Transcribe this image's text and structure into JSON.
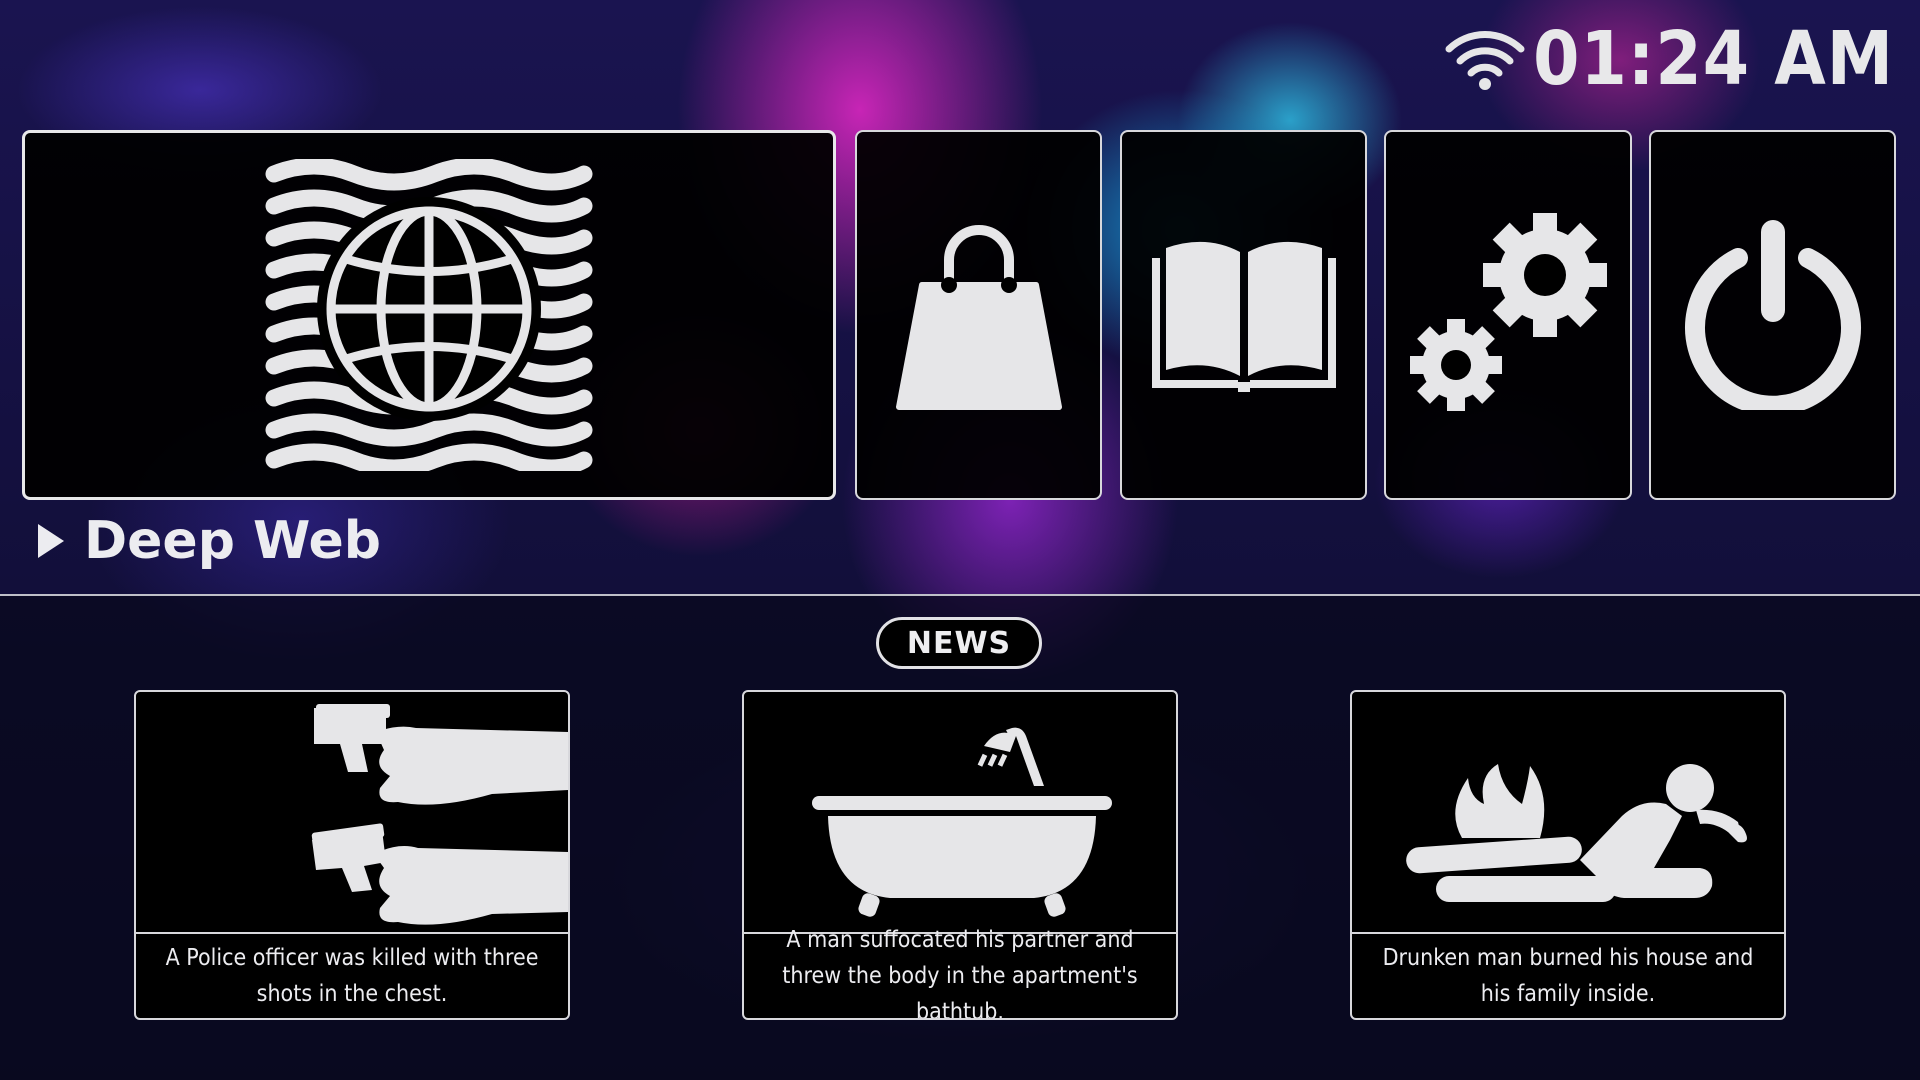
{
  "status_bar": {
    "wifi_icon": "wifi-icon",
    "time": "01:24 AM"
  },
  "menu": {
    "tiles": [
      {
        "id": "deep-web",
        "icon": "globe-waves-icon",
        "selected": true
      },
      {
        "id": "shop",
        "icon": "shopping-bag-icon"
      },
      {
        "id": "journal",
        "icon": "open-book-icon"
      },
      {
        "id": "settings",
        "icon": "gears-icon"
      },
      {
        "id": "power",
        "icon": "power-icon"
      }
    ],
    "selected_label": "Deep Web"
  },
  "news": {
    "title": "NEWS",
    "items": [
      {
        "icon": "pistols-icon",
        "caption": "A Police officer was killed with three shots in the chest."
      },
      {
        "icon": "bathtub-icon",
        "caption": "A man suffocated his partner and threw the body in the apartment's bathtub."
      },
      {
        "icon": "burning-man-icon",
        "caption": "Drunken man burned his house and his family inside."
      }
    ]
  },
  "colors": {
    "icon_fill": "#e6e6e8",
    "tile_background": "#000000",
    "border": "#d8d8dc"
  }
}
